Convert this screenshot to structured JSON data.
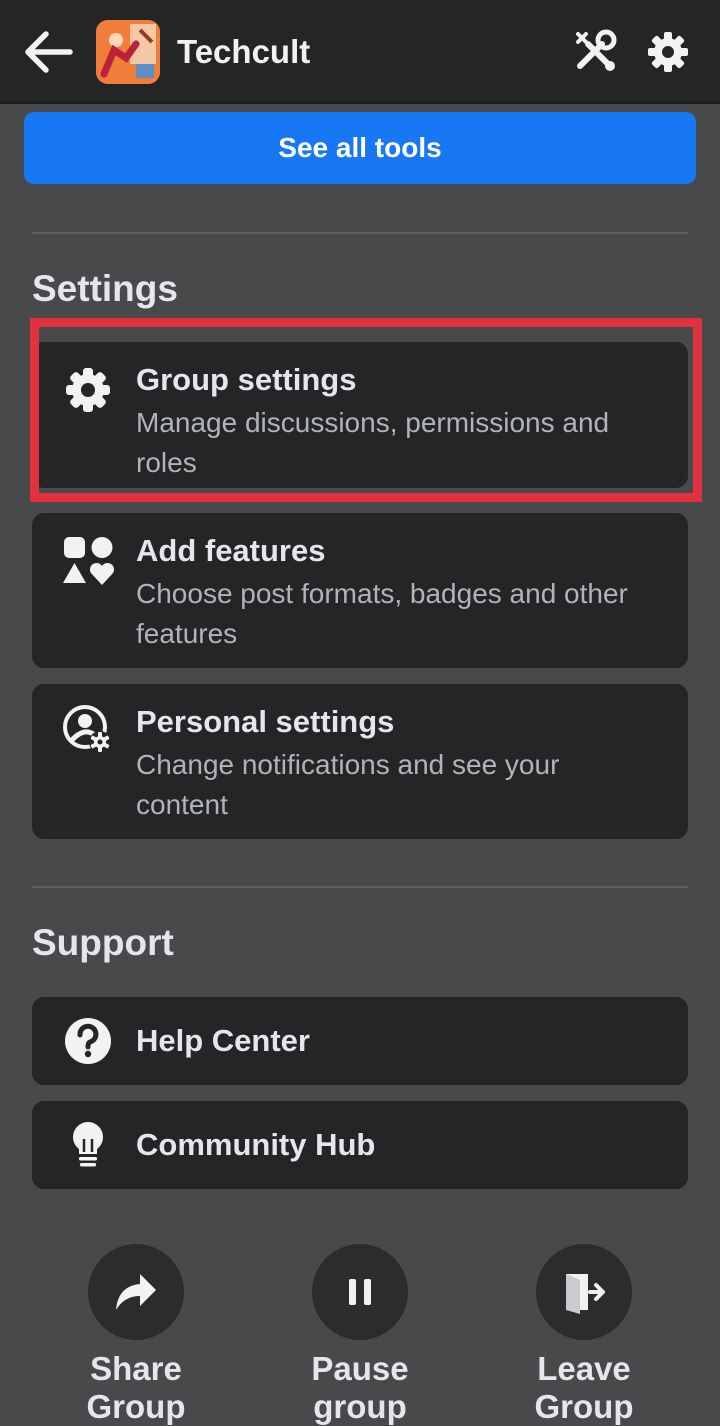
{
  "header": {
    "title": "Techcult",
    "back_icon": "arrow-left-icon",
    "tools_icon": "admin-tools-icon",
    "settings_icon": "gear-icon"
  },
  "see_all_tools": {
    "label": "See all tools"
  },
  "settings": {
    "title": "Settings",
    "items": [
      {
        "icon": "gear-icon",
        "title": "Group settings",
        "subtitle": "Manage discussions, permissions and roles",
        "highlighted": true
      },
      {
        "icon": "shapes-icon",
        "title": "Add features",
        "subtitle": "Choose post formats, badges and other features"
      },
      {
        "icon": "person-gear-icon",
        "title": "Personal settings",
        "subtitle": "Change notifications and see your content"
      }
    ]
  },
  "support": {
    "title": "Support",
    "items": [
      {
        "icon": "question-circle-icon",
        "title": "Help Center"
      },
      {
        "icon": "lightbulb-icon",
        "title": "Community Hub"
      }
    ]
  },
  "actions": [
    {
      "icon": "share-arrow-icon",
      "label": "Share\nGroup"
    },
    {
      "icon": "pause-icon",
      "label": "Pause\ngroup"
    },
    {
      "icon": "leave-door-icon",
      "label": "Leave\nGroup"
    }
  ],
  "colors": {
    "background": "#48494b",
    "card": "#242526",
    "accent": "#1877f2",
    "highlight": "#e0313f"
  }
}
